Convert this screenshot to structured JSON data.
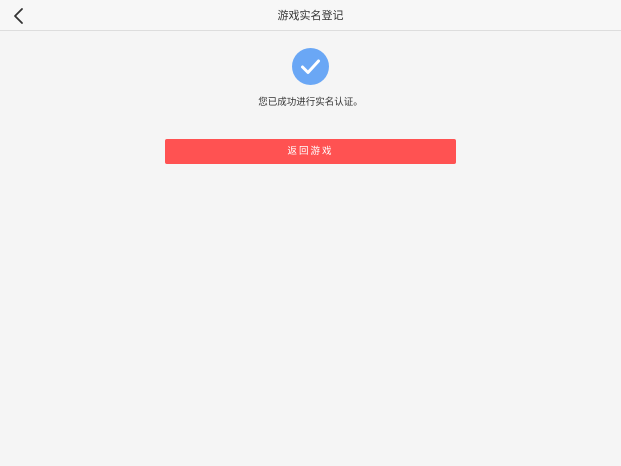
{
  "header": {
    "title": "游戏实名登记",
    "back_icon": "chevron-left-icon"
  },
  "main": {
    "success_icon": "check-circle-icon",
    "message": "您已成功进行实名认证。",
    "return_button_label": "返回游戏"
  },
  "colors": {
    "accent_blue": "#6aa7f5",
    "button_red": "#ff5252",
    "background": "#f5f5f5"
  }
}
